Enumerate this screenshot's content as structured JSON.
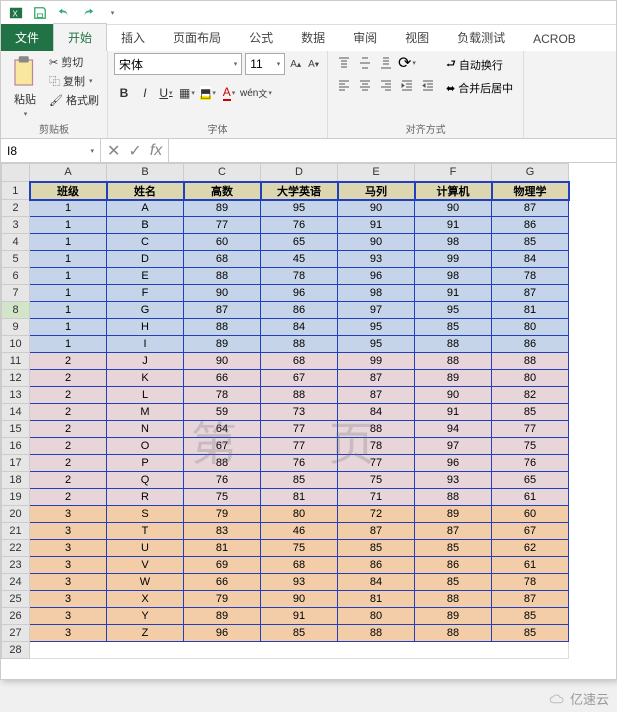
{
  "qat": {
    "save": "💾",
    "undo": "↶",
    "redo": "↷"
  },
  "tabs": {
    "file": "文件",
    "home": "开始",
    "insert": "插入",
    "layout": "页面布局",
    "formulas": "公式",
    "data": "数据",
    "review": "审阅",
    "view": "视图",
    "loadtest": "负载测试",
    "acrobat": "ACROB"
  },
  "ribbon": {
    "clipboard": {
      "paste": "粘贴",
      "cut": "剪切",
      "copy": "复制",
      "format_painter": "格式刷",
      "label": "剪贴板"
    },
    "font": {
      "name": "宋体",
      "size": "11",
      "bold": "B",
      "italic": "I",
      "underline": "U",
      "label": "字体"
    },
    "align": {
      "wrap": "自动换行",
      "merge": "合并后居中",
      "label": "对齐方式"
    }
  },
  "namebox": "I8",
  "fx": "fx",
  "columns": [
    "A",
    "B",
    "C",
    "D",
    "E",
    "F",
    "G"
  ],
  "headers": [
    "班级",
    "姓名",
    "高数",
    "大学英语",
    "马列",
    "计算机",
    "物理学"
  ],
  "rows": [
    {
      "z": 1,
      "c": [
        "1",
        "A",
        "89",
        "95",
        "90",
        "90",
        "87"
      ]
    },
    {
      "z": 1,
      "c": [
        "1",
        "B",
        "77",
        "76",
        "91",
        "91",
        "86"
      ]
    },
    {
      "z": 1,
      "c": [
        "1",
        "C",
        "60",
        "65",
        "90",
        "98",
        "85"
      ]
    },
    {
      "z": 1,
      "c": [
        "1",
        "D",
        "68",
        "45",
        "93",
        "99",
        "84"
      ]
    },
    {
      "z": 1,
      "c": [
        "1",
        "E",
        "88",
        "78",
        "96",
        "98",
        "78"
      ]
    },
    {
      "z": 1,
      "c": [
        "1",
        "F",
        "90",
        "96",
        "98",
        "91",
        "87"
      ]
    },
    {
      "z": 1,
      "c": [
        "1",
        "G",
        "87",
        "86",
        "97",
        "95",
        "81"
      ]
    },
    {
      "z": 1,
      "c": [
        "1",
        "H",
        "88",
        "84",
        "95",
        "85",
        "80"
      ]
    },
    {
      "z": 1,
      "c": [
        "1",
        "I",
        "89",
        "88",
        "95",
        "88",
        "86"
      ]
    },
    {
      "z": 2,
      "c": [
        "2",
        "J",
        "90",
        "68",
        "99",
        "88",
        "88"
      ]
    },
    {
      "z": 2,
      "c": [
        "2",
        "K",
        "66",
        "67",
        "87",
        "89",
        "80"
      ]
    },
    {
      "z": 2,
      "c": [
        "2",
        "L",
        "78",
        "88",
        "87",
        "90",
        "82"
      ]
    },
    {
      "z": 2,
      "c": [
        "2",
        "M",
        "59",
        "73",
        "84",
        "91",
        "85"
      ]
    },
    {
      "z": 2,
      "c": [
        "2",
        "N",
        "64",
        "77",
        "88",
        "94",
        "77"
      ]
    },
    {
      "z": 2,
      "c": [
        "2",
        "O",
        "67",
        "77",
        "78",
        "97",
        "75"
      ]
    },
    {
      "z": 2,
      "c": [
        "2",
        "P",
        "88",
        "76",
        "77",
        "96",
        "76"
      ]
    },
    {
      "z": 2,
      "c": [
        "2",
        "Q",
        "76",
        "85",
        "75",
        "93",
        "65"
      ]
    },
    {
      "z": 2,
      "c": [
        "2",
        "R",
        "75",
        "81",
        "71",
        "88",
        "61"
      ]
    },
    {
      "z": 3,
      "c": [
        "3",
        "S",
        "79",
        "80",
        "72",
        "89",
        "60"
      ]
    },
    {
      "z": 3,
      "c": [
        "3",
        "T",
        "83",
        "46",
        "87",
        "87",
        "67"
      ]
    },
    {
      "z": 3,
      "c": [
        "3",
        "U",
        "81",
        "75",
        "85",
        "85",
        "62"
      ]
    },
    {
      "z": 3,
      "c": [
        "3",
        "V",
        "69",
        "68",
        "86",
        "86",
        "61"
      ]
    },
    {
      "z": 3,
      "c": [
        "3",
        "W",
        "66",
        "93",
        "84",
        "85",
        "78"
      ]
    },
    {
      "z": 3,
      "c": [
        "3",
        "X",
        "79",
        "90",
        "81",
        "88",
        "87"
      ]
    },
    {
      "z": 3,
      "c": [
        "3",
        "Y",
        "89",
        "91",
        "80",
        "89",
        "85"
      ]
    },
    {
      "z": 3,
      "c": [
        "3",
        "Z",
        "96",
        "85",
        "88",
        "88",
        "85"
      ]
    }
  ],
  "watermark": "第 页",
  "footer": "亿速云",
  "selected_row": 8
}
